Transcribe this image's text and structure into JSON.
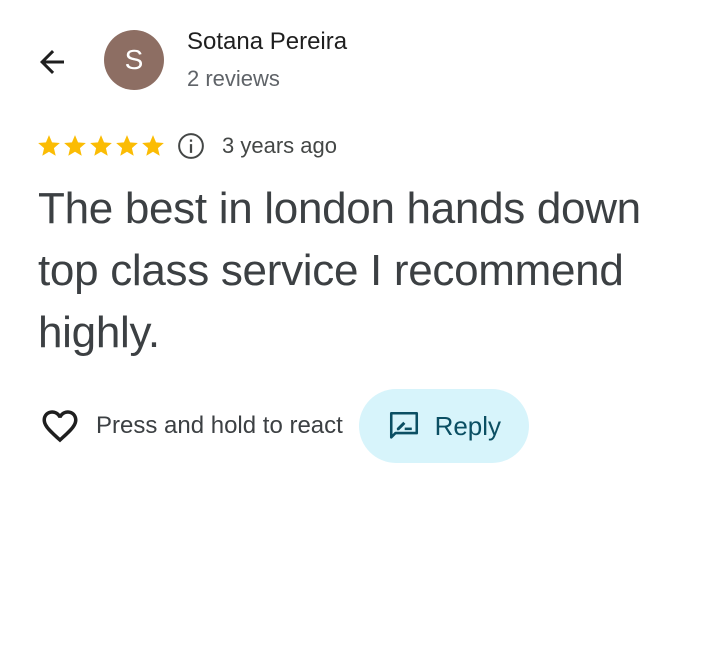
{
  "reviewer": {
    "avatar_initial": "S",
    "name": "Sotana Pereira",
    "review_count": "2 reviews"
  },
  "rating": {
    "stars": 5,
    "max_stars": 5,
    "time_ago": "3 years ago"
  },
  "review": {
    "text": "The best in london hands down top class service I recommend highly."
  },
  "actions": {
    "react_label": "Press and hold to react",
    "reply_label": "Reply"
  },
  "colors": {
    "star": "#fbbc04",
    "avatar_bg": "#8d6e63",
    "reply_bg": "#d7f4fb",
    "reply_text": "#0b4f63"
  },
  "icons": {
    "back": "arrow-back-icon",
    "info": "info-icon",
    "heart": "heart-outline-icon",
    "reply": "reply-icon"
  }
}
